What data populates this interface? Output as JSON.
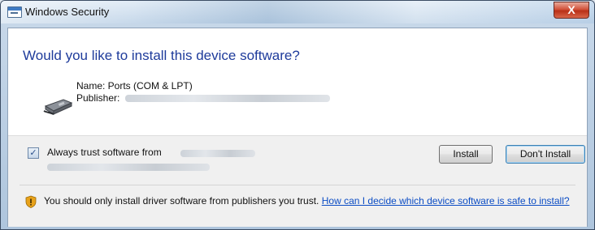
{
  "window": {
    "title": "Windows Security",
    "close_label": "X"
  },
  "dialog": {
    "headline": "Would you like to install this device software?",
    "device_name": "Name: Ports (COM & LPT)",
    "publisher_label": "Publisher:"
  },
  "trust": {
    "checked": true,
    "check_mark": "✓",
    "label": "Always trust software from"
  },
  "buttons": {
    "install": "Install",
    "dont_install": "Don't Install"
  },
  "warning": {
    "text": "You should only install driver software from publishers you trust.",
    "link": "How can I decide which device software is safe to install?"
  },
  "icons": {
    "title": "security-window-icon",
    "device": "ports-device-icon",
    "warning": "shield-warning-icon"
  }
}
